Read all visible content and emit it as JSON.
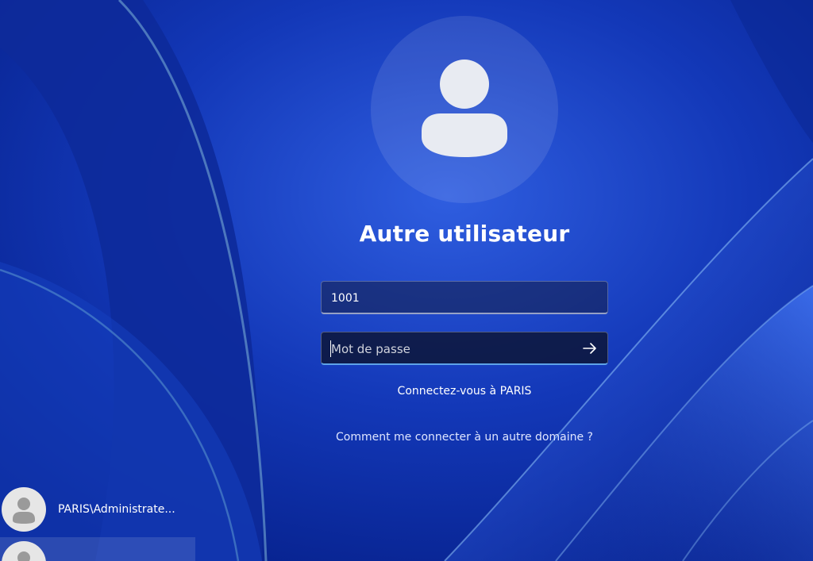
{
  "login": {
    "username": "Autre utilisateur",
    "user_field_value": "1001",
    "password_placeholder": "Mot de passe",
    "domain_text": "Connectez-vous à PARIS",
    "other_domain_link": "Comment me connecter à un autre domaine ?"
  },
  "accounts": [
    {
      "label": "PARIS\\Administrate..."
    },
    {
      "label": ""
    }
  ],
  "icons": {
    "avatar": "user-silhouette-icon",
    "submit": "arrow-right-icon"
  },
  "colors": {
    "background": "#0a2a9e",
    "text": "#ffffff",
    "focus_underline": "#5ea3e8"
  }
}
